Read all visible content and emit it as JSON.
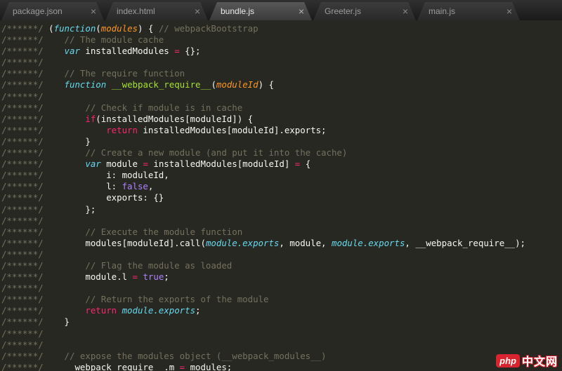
{
  "tabs": [
    {
      "id": "package-json",
      "label": "package.json",
      "active": false
    },
    {
      "id": "index-html",
      "label": "index.html",
      "active": false
    },
    {
      "id": "bundle-js",
      "label": "bundle.js",
      "active": true
    },
    {
      "id": "greeter-js",
      "label": "Greeter.js",
      "active": false
    },
    {
      "id": "main-js",
      "label": "main.js",
      "active": false
    }
  ],
  "icons": {
    "close": "×"
  },
  "theme": {
    "background": "#272822",
    "tab_bar": "#1e1e1e",
    "active_tab": "#4a4a4a",
    "comment": "#75715e",
    "keyword": "#f92672",
    "storage": "#66d9ef",
    "function_name": "#a6e22e",
    "parameter": "#fd971f",
    "constant": "#ae81ff",
    "text": "#f8f8f2",
    "watermark_red": "#d9232e"
  },
  "watermark": {
    "logo": "php",
    "text": "中文网"
  },
  "code": {
    "lines": [
      [
        [
          "cm",
          "/******/ "
        ],
        [
          "p",
          "("
        ],
        [
          "st",
          "function"
        ],
        [
          "p",
          "("
        ],
        [
          "par",
          "modules"
        ],
        [
          "p",
          ") { "
        ],
        [
          "cm",
          "// webpackBootstrap"
        ]
      ],
      [
        [
          "cm",
          "/******/ "
        ],
        [
          "p",
          "   "
        ],
        [
          "cm",
          "// The module cache"
        ]
      ],
      [
        [
          "cm",
          "/******/ "
        ],
        [
          "p",
          "   "
        ],
        [
          "st",
          "var"
        ],
        [
          "p",
          " installedModules "
        ],
        [
          "op",
          "="
        ],
        [
          "p",
          " {};"
        ]
      ],
      [
        [
          "cm",
          "/******/"
        ]
      ],
      [
        [
          "cm",
          "/******/ "
        ],
        [
          "p",
          "   "
        ],
        [
          "cm",
          "// The require function"
        ]
      ],
      [
        [
          "cm",
          "/******/ "
        ],
        [
          "p",
          "   "
        ],
        [
          "st",
          "function"
        ],
        [
          "p",
          " "
        ],
        [
          "fn",
          "__webpack_require__"
        ],
        [
          "p",
          "("
        ],
        [
          "par",
          "moduleId"
        ],
        [
          "p",
          ") {"
        ]
      ],
      [
        [
          "cm",
          "/******/"
        ]
      ],
      [
        [
          "cm",
          "/******/ "
        ],
        [
          "p",
          "       "
        ],
        [
          "cm",
          "// Check if module is in cache"
        ]
      ],
      [
        [
          "cm",
          "/******/ "
        ],
        [
          "p",
          "       "
        ],
        [
          "kw",
          "if"
        ],
        [
          "p",
          "(installedModules[moduleId]) {"
        ]
      ],
      [
        [
          "cm",
          "/******/ "
        ],
        [
          "p",
          "           "
        ],
        [
          "kw",
          "return"
        ],
        [
          "p",
          " installedModules[moduleId].exports;"
        ]
      ],
      [
        [
          "cm",
          "/******/ "
        ],
        [
          "p",
          "       }"
        ]
      ],
      [
        [
          "cm",
          "/******/ "
        ],
        [
          "p",
          "       "
        ],
        [
          "cm",
          "// Create a new module (and put it into the cache)"
        ]
      ],
      [
        [
          "cm",
          "/******/ "
        ],
        [
          "p",
          "       "
        ],
        [
          "st",
          "var"
        ],
        [
          "p",
          " module "
        ],
        [
          "op",
          "="
        ],
        [
          "p",
          " installedModules[moduleId] "
        ],
        [
          "op",
          "="
        ],
        [
          "p",
          " {"
        ]
      ],
      [
        [
          "cm",
          "/******/ "
        ],
        [
          "p",
          "           i: moduleId,"
        ]
      ],
      [
        [
          "cm",
          "/******/ "
        ],
        [
          "p",
          "           l: "
        ],
        [
          "cn",
          "false"
        ],
        [
          "p",
          ","
        ]
      ],
      [
        [
          "cm",
          "/******/ "
        ],
        [
          "p",
          "           exports: {}"
        ]
      ],
      [
        [
          "cm",
          "/******/ "
        ],
        [
          "p",
          "       };"
        ]
      ],
      [
        [
          "cm",
          "/******/"
        ]
      ],
      [
        [
          "cm",
          "/******/ "
        ],
        [
          "p",
          "       "
        ],
        [
          "cm",
          "// Execute the module function"
        ]
      ],
      [
        [
          "cm",
          "/******/ "
        ],
        [
          "p",
          "       modules[moduleId].call("
        ],
        [
          "it",
          "module.exports"
        ],
        [
          "p",
          ", module, "
        ],
        [
          "it",
          "module.exports"
        ],
        [
          "p",
          ", __webpack_require__);"
        ]
      ],
      [
        [
          "cm",
          "/******/"
        ]
      ],
      [
        [
          "cm",
          "/******/ "
        ],
        [
          "p",
          "       "
        ],
        [
          "cm",
          "// Flag the module as loaded"
        ]
      ],
      [
        [
          "cm",
          "/******/ "
        ],
        [
          "p",
          "       module.l "
        ],
        [
          "op",
          "="
        ],
        [
          "p",
          " "
        ],
        [
          "cn",
          "true"
        ],
        [
          "p",
          ";"
        ]
      ],
      [
        [
          "cm",
          "/******/"
        ]
      ],
      [
        [
          "cm",
          "/******/ "
        ],
        [
          "p",
          "       "
        ],
        [
          "cm",
          "// Return the exports of the module"
        ]
      ],
      [
        [
          "cm",
          "/******/ "
        ],
        [
          "p",
          "       "
        ],
        [
          "kw",
          "return"
        ],
        [
          "p",
          " "
        ],
        [
          "it",
          "module.exports"
        ],
        [
          "p",
          ";"
        ]
      ],
      [
        [
          "cm",
          "/******/ "
        ],
        [
          "p",
          "   }"
        ]
      ],
      [
        [
          "cm",
          "/******/"
        ]
      ],
      [
        [
          "cm",
          "/******/"
        ]
      ],
      [
        [
          "cm",
          "/******/ "
        ],
        [
          "p",
          "   "
        ],
        [
          "cm",
          "// expose the modules object (__webpack_modules__)"
        ]
      ],
      [
        [
          "cm",
          "/******/ "
        ],
        [
          "p",
          "   __webpack_require__.m "
        ],
        [
          "op",
          "="
        ],
        [
          "p",
          " modules;"
        ]
      ]
    ]
  }
}
